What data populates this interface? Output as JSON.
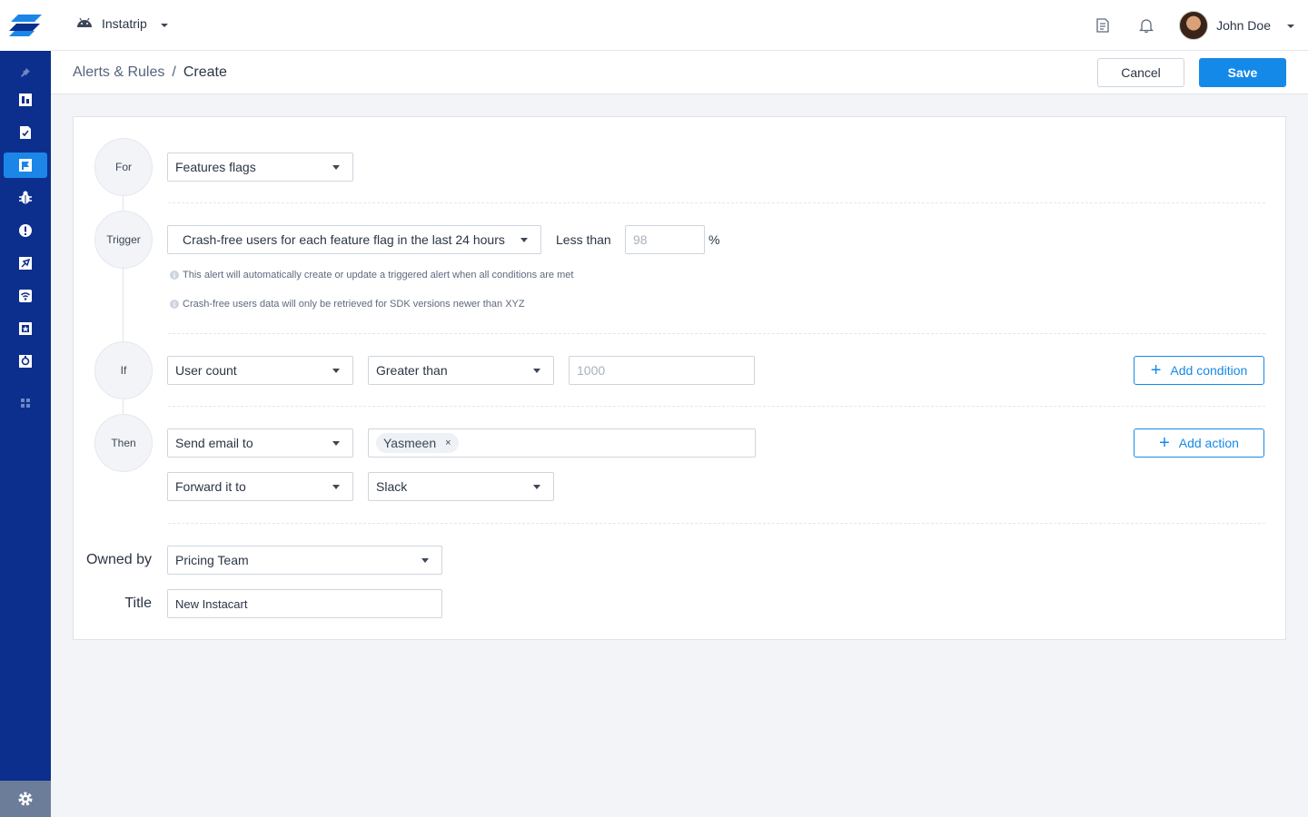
{
  "topbar": {
    "app_name": "Instatrip",
    "user_name": "John Doe"
  },
  "header": {
    "breadcrumb_parent": "Alerts & Rules",
    "breadcrumb_separator": "/",
    "breadcrumb_current": "Create",
    "cancel_label": "Cancel",
    "save_label": "Save"
  },
  "steps": {
    "for": "For",
    "trigger": "Trigger",
    "if": "If",
    "then": "Then"
  },
  "form": {
    "for_select": "Features flags",
    "trigger_select": "Crash-free users for each feature flag in the last 24 hours",
    "trigger_operator": "Less than",
    "trigger_value_placeholder": "98",
    "trigger_unit": "%",
    "hint_1": "This alert will automatically create or update a triggered alert when all conditions are met",
    "hint_2": "Crash-free users data will only be retrieved for SDK versions newer than XYZ",
    "if_field": "User count",
    "if_operator": "Greater than",
    "if_value_placeholder": "1000",
    "add_condition_label": "Add condition",
    "then_action_1": "Send email to",
    "then_recipient_tag": "Yasmeen",
    "tag_remove": "×",
    "then_action_2": "Forward it to",
    "then_target_2": "Slack",
    "add_action_label": "Add action",
    "owned_by_label": "Owned by",
    "owned_by_value": "Pricing Team",
    "title_label": "Title",
    "title_value": "New Instacart"
  },
  "colors": {
    "sidebar": "#0c2f8e",
    "accent": "#1589e8",
    "background": "#f2f4f7"
  },
  "icons": [
    "logo-icon",
    "android-icon",
    "docs-icon",
    "bell-icon",
    "pin-icon",
    "dashboard-icon",
    "report-icon",
    "flag-icon",
    "bug-icon",
    "alert-icon",
    "release-icon",
    "network-icon",
    "features-icon",
    "survey-icon",
    "apps-grid-icon",
    "settings-icon"
  ]
}
